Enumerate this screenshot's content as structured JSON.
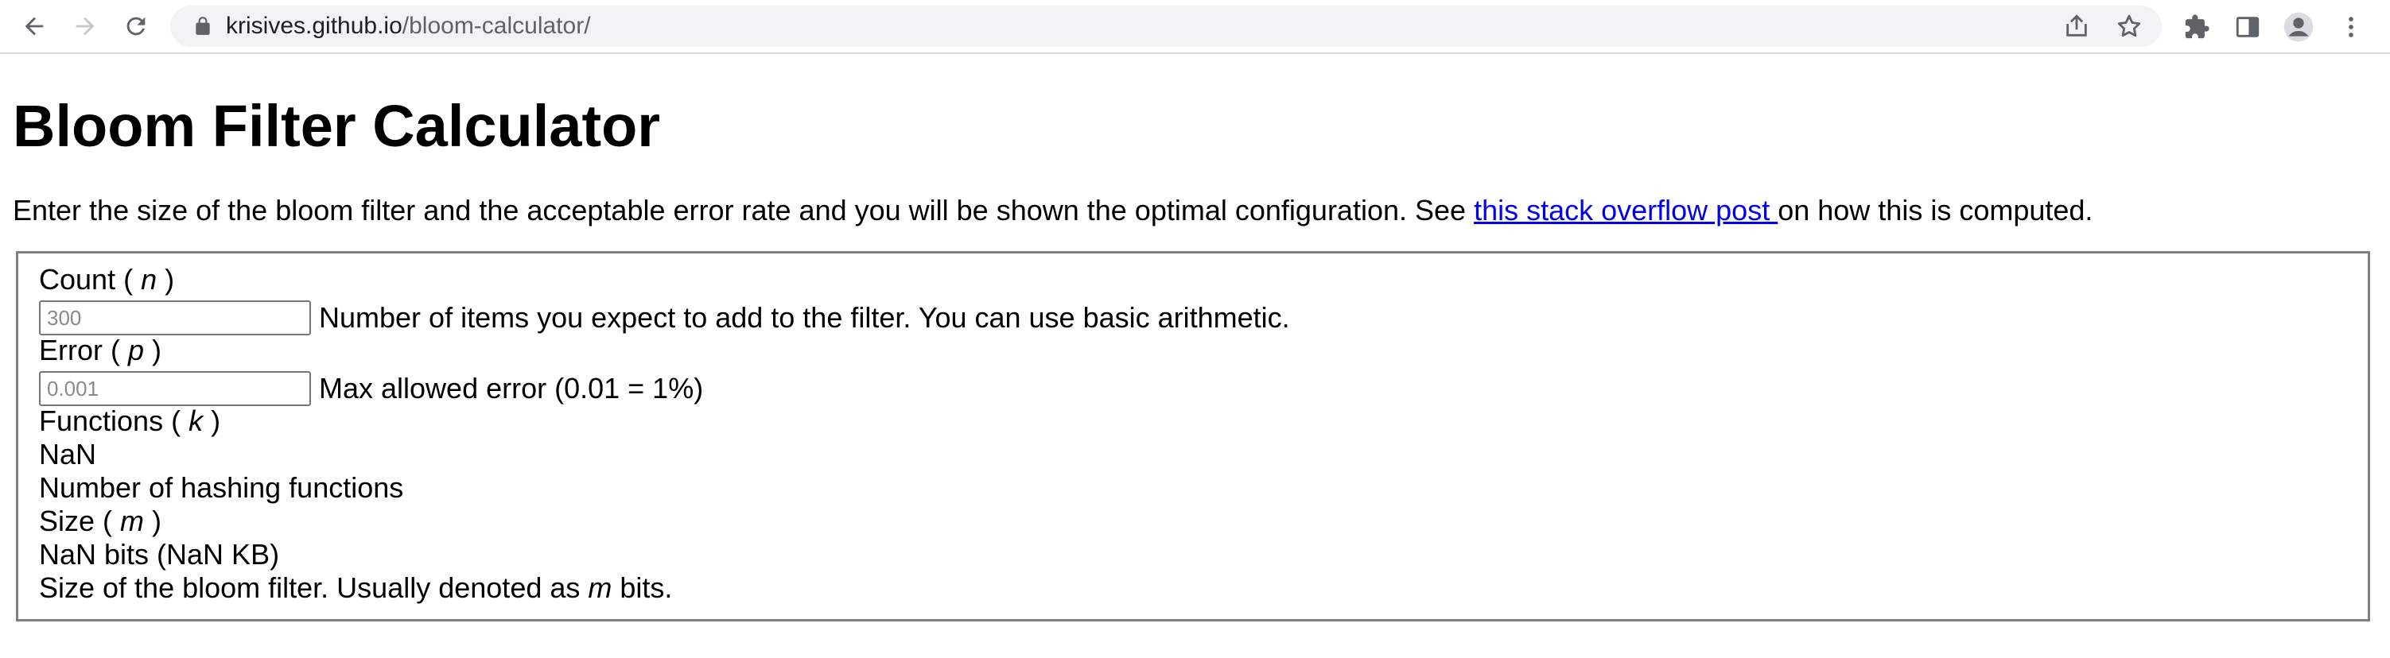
{
  "browser": {
    "url_domain": "krisives.github.io",
    "url_path": "/bloom-calculator/",
    "icons": [
      "back-arrow-icon",
      "forward-arrow-icon",
      "reload-icon",
      "lock-icon",
      "share-icon",
      "star-icon",
      "extensions-icon",
      "side-panel-icon",
      "profile-icon",
      "kebab-menu-icon"
    ]
  },
  "page": {
    "title": "Bloom Filter Calculator",
    "intro_text": "Enter the size of the bloom filter and the acceptable error rate and you will be shown the optimal configuration. See ",
    "intro_link": "this stack overflow post ",
    "intro_suffix": "on how this is computed."
  },
  "calculator": {
    "count": {
      "label": "Count ( ",
      "var": "n",
      "label_end": " )",
      "placeholder": "300",
      "value": "",
      "hint": "Number of items you expect to add to the filter. You can use basic arithmetic."
    },
    "error": {
      "label": "Error ( ",
      "var": "p",
      "label_end": " )",
      "placeholder": "0.001",
      "value": "",
      "hint": "Max allowed error (0.01 = 1%)"
    },
    "functions": {
      "label": "Functions ( ",
      "var": "k",
      "label_end": " )",
      "result": "NaN",
      "description": "Number of hashing functions"
    },
    "size": {
      "label": "Size ( ",
      "var": "m",
      "label_end": " )",
      "result": "NaN bits (NaN KB)",
      "description_prefix": "Size of the bloom filter. Usually denoted as ",
      "description_var": "m",
      "description_suffix": " bits."
    }
  },
  "colors": {
    "link": "#0000ee",
    "box_border": "#808080",
    "omnibox_bg": "#f1f3f4"
  }
}
